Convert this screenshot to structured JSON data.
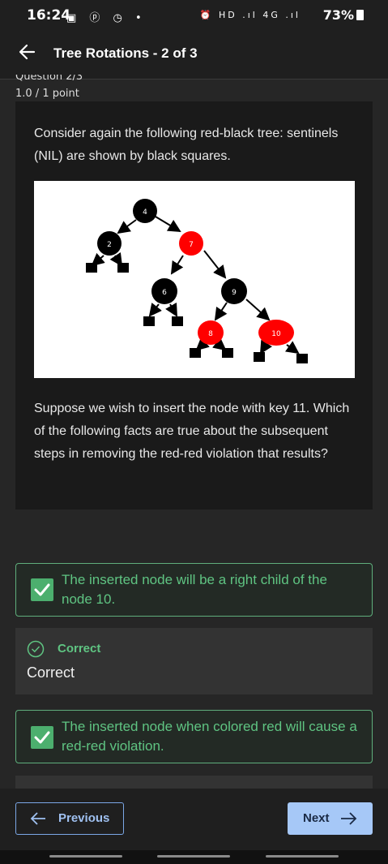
{
  "status": {
    "time": "16:24",
    "left_icons": "▣ ⓟ ◷ •",
    "right_icons": "⏰ HD .ıl 4G .ıl",
    "battery": "73%"
  },
  "header": {
    "title": "Tree Rotations - 2 of 3"
  },
  "question": {
    "label": "Question 2/3",
    "points": "1.0 / 1 point",
    "intro": "Consider again the following red-black tree: sentinels (NIL) are shown by black squares.",
    "prompt": "Suppose we wish to insert the node with key 11. Which of the following facts are true about the subsequent steps in removing the red-red violation that results?"
  },
  "tree": {
    "nodes": [
      {
        "key": "4",
        "color": "black"
      },
      {
        "key": "2",
        "color": "black"
      },
      {
        "key": "7",
        "color": "red"
      },
      {
        "key": "6",
        "color": "black"
      },
      {
        "key": "9",
        "color": "black"
      },
      {
        "key": "8",
        "color": "red"
      },
      {
        "key": "10",
        "color": "red"
      }
    ],
    "colors": {
      "red": "#ff0000",
      "black": "#000000"
    }
  },
  "answers": [
    {
      "text": "The inserted node will be a right child of the node 10.",
      "checked": true
    },
    {
      "text": "The inserted node when colored red will cause a red-red violation.",
      "checked": true
    }
  ],
  "feedback": {
    "title": "Correct",
    "text": "Correct"
  },
  "nav": {
    "previous": "Previous",
    "next": "Next"
  },
  "accent": {
    "correct": "#5fc482",
    "primary": "#a6c8f7"
  }
}
